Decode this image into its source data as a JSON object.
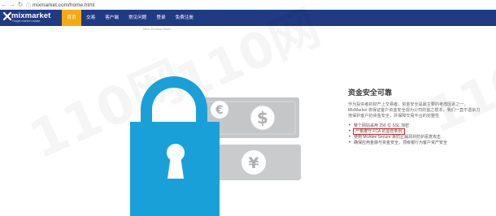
{
  "browser": {
    "url": "mixmarket.com/home.html"
  },
  "header": {
    "logo_text": "mixmarket",
    "logo_sub": "Forget market Leader",
    "nav": [
      {
        "label": "首页",
        "active": true
      },
      {
        "label": "交易"
      },
      {
        "label": "客户端"
      },
      {
        "label": "常见问题"
      },
      {
        "label": "登录"
      },
      {
        "label": "免费注册"
      }
    ],
    "subline": "Mixo Technol Bisbil"
  },
  "content": {
    "title": "资金安全可靠",
    "paragraph": "作为投资者的财产上交易者，资金安全是最主要的考虑因素之一。MixMarket 将保证客户资金安全视为公司的首之根本，我们一直不遗余力地保护客户的资金安全，并保障交易平台的完整性",
    "list": [
      {
        "text": "整个网站采用 256 位 SSL 加密"
      },
      {
        "text": "严格遵守 FCA 的监管条例",
        "highlight": true
      },
      {
        "text": "使用 McAfee Secure 来防止漏洞并防护恶意攻击"
      },
      {
        "text": "确保应用金融与资金安全，顶级银行为客户资产安全"
      }
    ]
  },
  "watermark": {
    "text": "110网"
  },
  "colors": {
    "header_bg": "#203a84",
    "nav_active": "#f3a912",
    "lock_blue": "#1aa0d8",
    "note_gray": "#bfc1c3",
    "highlight_border": "#e02020"
  }
}
